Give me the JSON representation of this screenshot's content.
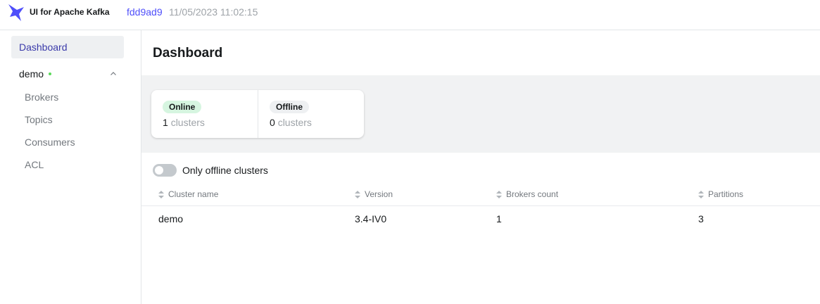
{
  "header": {
    "app_title": "UI for Apache Kafka",
    "commit": "fdd9ad9",
    "build_date": "11/05/2023 11:02:15",
    "brand_color": "#4f4ffa"
  },
  "sidebar": {
    "dashboard_label": "Dashboard",
    "cluster": {
      "name": "demo",
      "status": "online",
      "expanded": true,
      "items": [
        "Brokers",
        "Topics",
        "Consumers",
        "ACL"
      ]
    }
  },
  "main": {
    "title": "Dashboard",
    "stats": {
      "online": {
        "badge": "Online",
        "count": "1",
        "unit": "clusters"
      },
      "offline": {
        "badge": "Offline",
        "count": "0",
        "unit": "clusters"
      }
    },
    "toggle": {
      "label": "Only offline clusters",
      "checked": false
    },
    "table": {
      "columns": [
        "Cluster name",
        "Version",
        "Brokers count",
        "Partitions"
      ],
      "rows": [
        [
          "demo",
          "3.4-IV0",
          "1",
          "3"
        ]
      ]
    }
  }
}
